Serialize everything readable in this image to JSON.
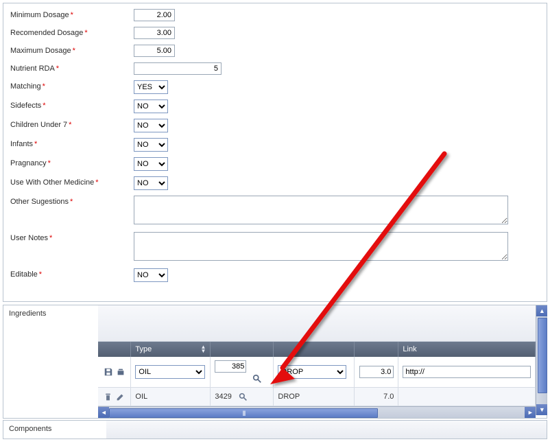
{
  "form": {
    "min_dosage": {
      "label": "Minimum Dosage",
      "value": "2.00"
    },
    "rec_dosage": {
      "label": "Recomended Dosage",
      "value": "3.00"
    },
    "max_dosage": {
      "label": "Maximum Dosage",
      "value": "5.00"
    },
    "nutrient_rda": {
      "label": "Nutrient RDA",
      "value": "5"
    },
    "matching": {
      "label": "Matching",
      "value": "YES"
    },
    "sidefects": {
      "label": "Sidefects",
      "value": "NO"
    },
    "children_under_7": {
      "label": "Children Under 7",
      "value": "NO"
    },
    "infants": {
      "label": "Infants",
      "value": "NO"
    },
    "pragnancy": {
      "label": "Pragnancy",
      "value": "NO"
    },
    "use_with_other": {
      "label": "Use With Other Medicine",
      "value": "NO"
    },
    "other_sugestions": {
      "label": "Other Sugestions",
      "value": ""
    },
    "user_notes": {
      "label": "User Notes",
      "value": ""
    },
    "editable": {
      "label": "Editable",
      "value": "NO"
    }
  },
  "yn_options": [
    "YES",
    "NO"
  ],
  "ingredients": {
    "title": "Ingredients",
    "headers": {
      "type": "Type",
      "link": "Link"
    },
    "type_options": [
      "OIL"
    ],
    "unit_options": [
      "DROP"
    ],
    "edit_row": {
      "type": "OIL",
      "code": "385",
      "unit": "DROP",
      "qty": "3.0",
      "link": "http://"
    },
    "rows": [
      {
        "type": "OIL",
        "code": "3429",
        "unit": "DROP",
        "qty": "7.0",
        "link": ""
      }
    ]
  },
  "components": {
    "title": "Components"
  }
}
